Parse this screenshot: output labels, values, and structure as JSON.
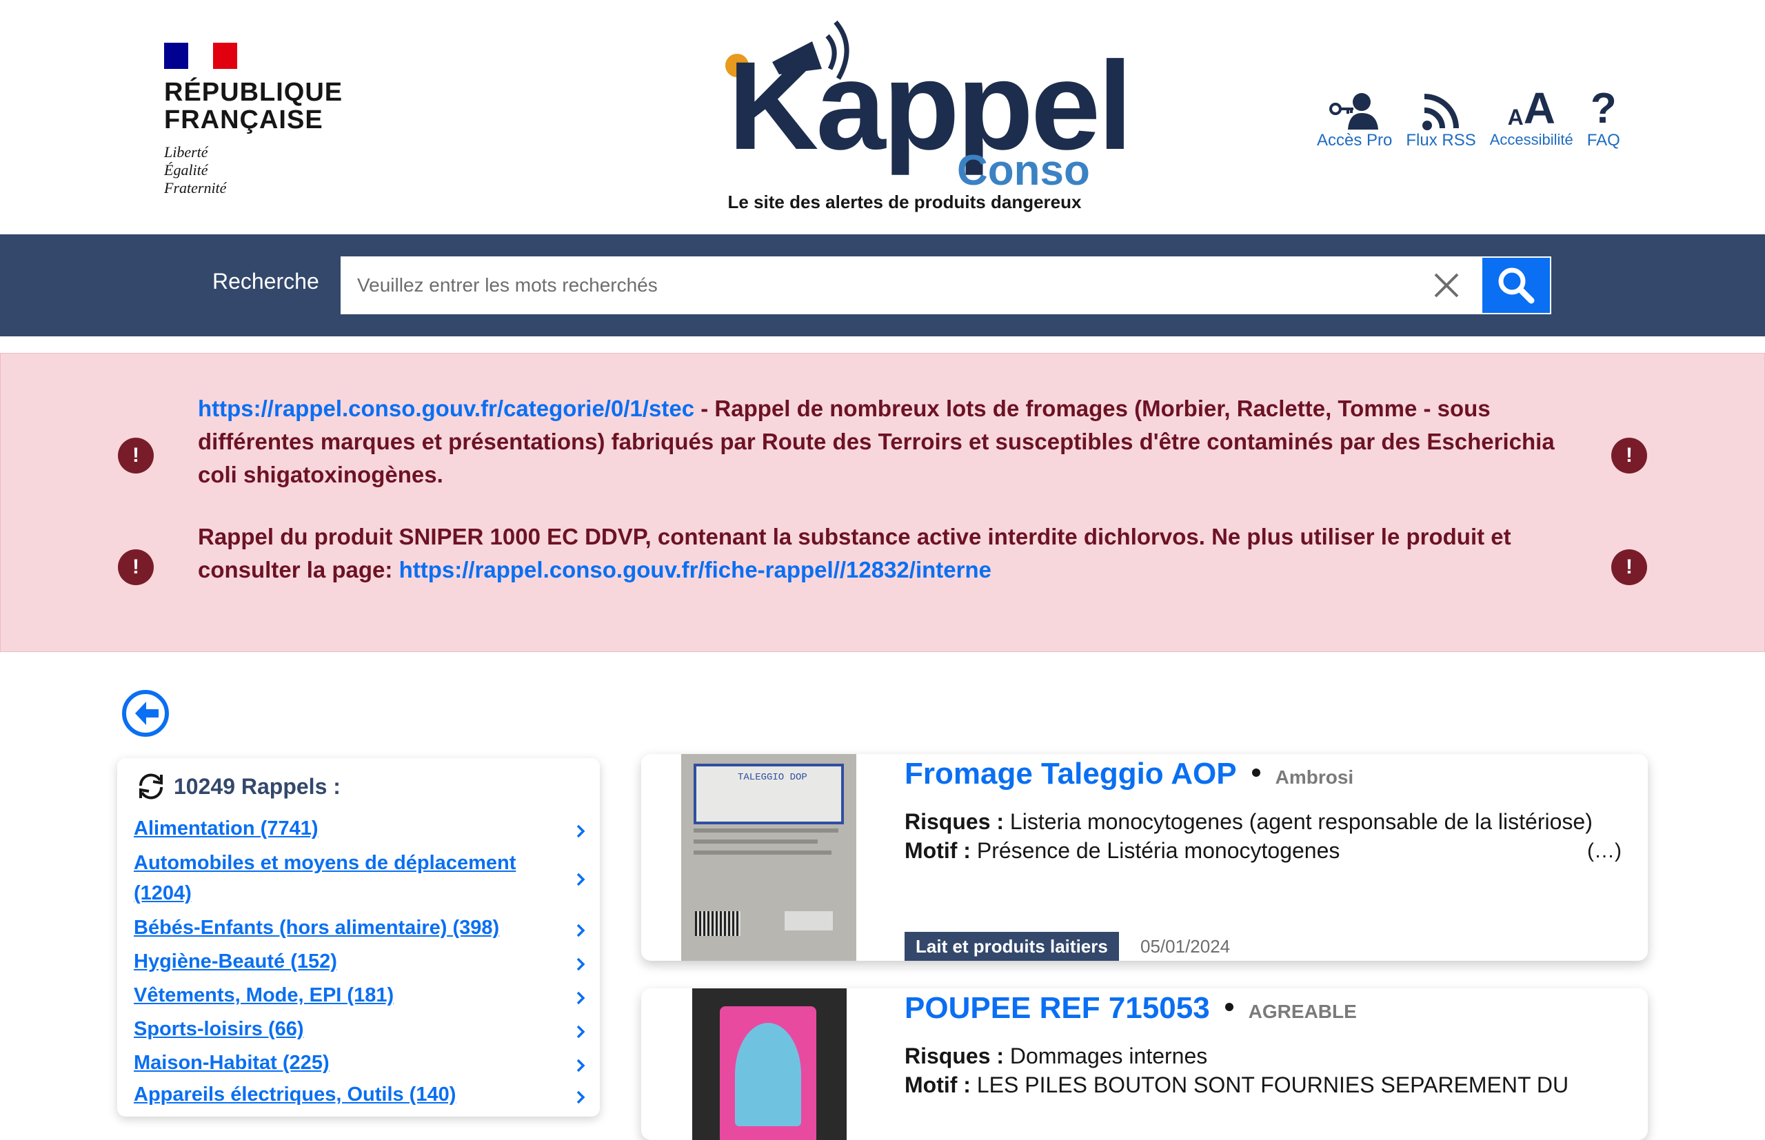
{
  "header": {
    "rf_title_line1": "RÉPUBLIQUE",
    "rf_title_line2": "FRANÇAISE",
    "motto_1": "Liberté",
    "motto_2": "Égalité",
    "motto_3": "Fraternité",
    "logo_word": "Kappel",
    "logo_sub": "Conso",
    "tagline": "Le site des alertes de produits dangereux",
    "tools": [
      {
        "label": "Accès Pro",
        "icon": "user-key-icon"
      },
      {
        "label": "Flux RSS",
        "icon": "rss-icon"
      },
      {
        "label": "Accessibilité",
        "icon": "text-size-icon"
      },
      {
        "label": "FAQ",
        "icon": "question-icon"
      }
    ]
  },
  "search": {
    "label": "Recherche",
    "placeholder": "Veuillez entrer les mots recherchés",
    "value": ""
  },
  "alerts": [
    {
      "link": "https://rappel.conso.gouv.fr/categorie/0/1/stec",
      "text": " - Rappel de nombreux lots de fromages (Morbier, Raclette, Tomme - sous différentes marques et présentations) fabriqués par Route des Terroirs et susceptibles d'être contaminés par des Escherichia coli shigatoxinogènes."
    },
    {
      "text": "Rappel du produit SNIPER 1000 EC DDVP, contenant la substance active interdite dichlorvos. Ne plus utiliser le produit et consulter la page: ",
      "link": "https://rappel.conso.gouv.fr/fiche-rappel//12832/interne"
    }
  ],
  "sidebar": {
    "count_label": "10249 Rappels  :",
    "categories": [
      {
        "label": "Alimentation (7741)"
      },
      {
        "label": "Automobiles et moyens de déplacement (1204)"
      },
      {
        "label": "Bébés-Enfants (hors alimentaire) (398)"
      },
      {
        "label": "Hygiène-Beauté (152)"
      },
      {
        "label": "Vêtements, Mode, EPI (181)"
      },
      {
        "label": "Sports-loisirs (66)"
      },
      {
        "label": "Maison-Habitat (225)"
      },
      {
        "label": "Appareils électriques, Outils (140)"
      }
    ]
  },
  "cards": [
    {
      "name": "Fromage Taleggio AOP",
      "brand": "Ambrosi",
      "risk_label": "Risques :",
      "risk": " Listeria monocytogenes (agent responsable de la listériose)",
      "motif_label": "Motif :",
      "motif": " Présence de Listéria monocytogenes",
      "more": "(…)",
      "category": "Lait et produits laitiers",
      "date": "05/01/2024",
      "image_text": "TALEGGIO DOP"
    },
    {
      "name": "POUPEE REF 715053",
      "brand": "AGREABLE",
      "risk_label": "Risques :",
      "risk": " Dommages internes",
      "motif_label": "Motif :",
      "motif": " LES PILES BOUTON SONT FOURNIES SEPAREMENT DU"
    }
  ]
}
